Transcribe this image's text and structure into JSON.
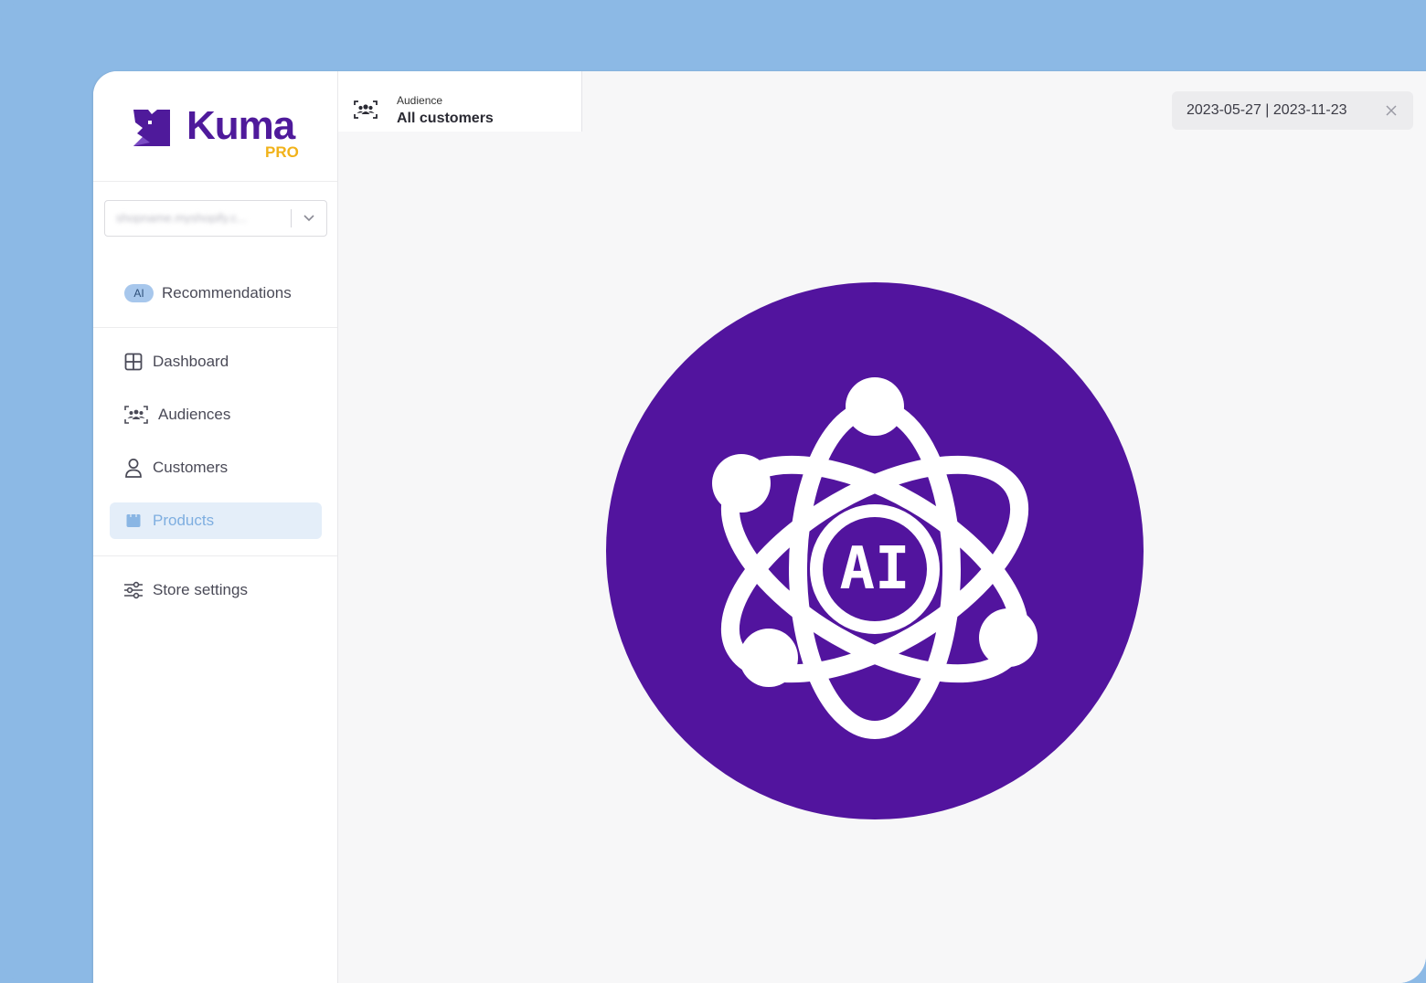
{
  "logo": {
    "word": "Kuma",
    "badge": "PRO"
  },
  "store_selector": {
    "value": "shopname.myshopify.c..."
  },
  "nav": {
    "recommendations": {
      "pill": "AI",
      "label": "Recommendations"
    },
    "items": [
      {
        "label": "Dashboard",
        "icon": "grid-icon"
      },
      {
        "label": "Audiences",
        "icon": "audience-icon"
      },
      {
        "label": "Customers",
        "icon": "user-icon"
      },
      {
        "label": "Products",
        "icon": "box-icon",
        "active": true
      }
    ],
    "settings": {
      "label": "Store settings",
      "icon": "sliders-icon"
    }
  },
  "topbar": {
    "audience_label": "Audience",
    "audience_value": "All customers",
    "date_range": "2023-05-27 | 2023-11-23"
  },
  "hero": {
    "text": "AI",
    "icon": "atom-ai-icon"
  },
  "colors": {
    "brand": "#52149e",
    "accent_yellow": "#f1b21a",
    "backdrop": "#8cb9e5",
    "active_nav": "#e4eef9"
  }
}
